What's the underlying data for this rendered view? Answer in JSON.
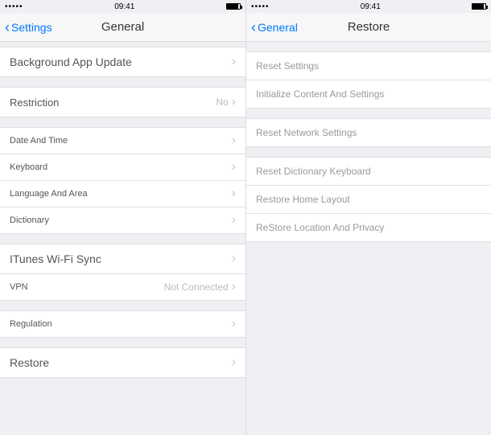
{
  "statusBar": {
    "time": "09:41"
  },
  "left": {
    "back": "Settings",
    "title": "General",
    "rows": {
      "backgroundAppUpdate": "Background App Update",
      "restriction": {
        "label": "Restriction",
        "value": "No"
      },
      "dateTime": "Date And Time",
      "keyboard": "Keyboard",
      "languageArea": "Language And Area",
      "dictionary": "Dictionary",
      "itunesWifi": "ITunes Wi-Fi Sync",
      "vpn": {
        "label": "VPN",
        "value": "Not Connected"
      },
      "regulation": "Regulation",
      "restore": "Restore"
    }
  },
  "right": {
    "back": "General",
    "title": "Restore",
    "rows": {
      "resetSettings": "Reset Settings",
      "initializeContent": "Initialize Content And Settings",
      "resetNetwork": "Reset Network Settings",
      "resetDictionary": "Reset Dictionary Keyboard",
      "restoreHome": "Restore Home Layout",
      "restoreLocation": "ReStore Location And Privacy"
    }
  }
}
